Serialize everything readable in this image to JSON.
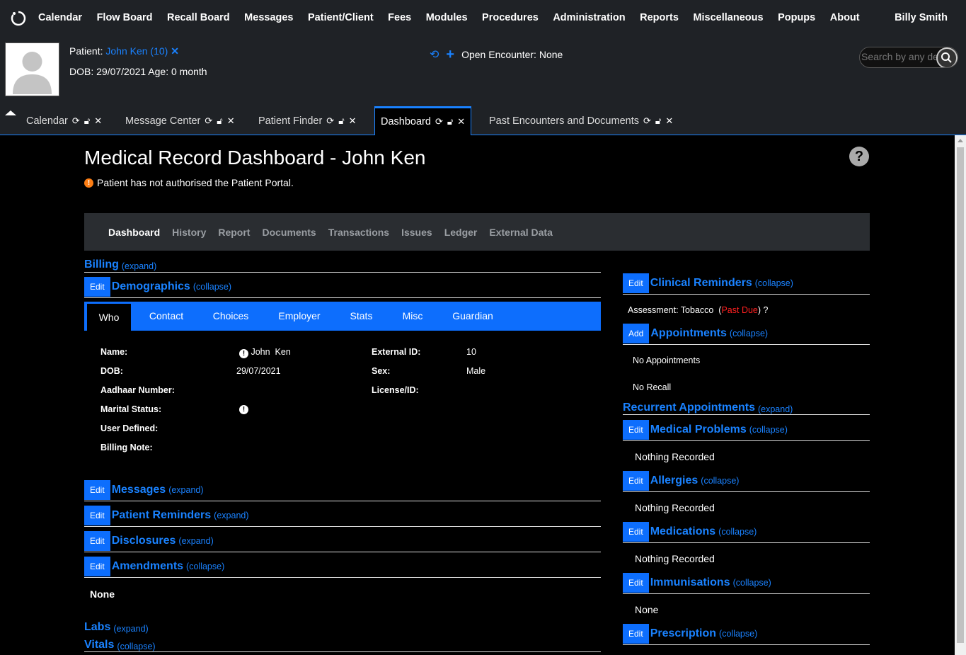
{
  "nav": {
    "items": [
      "Calendar",
      "Flow Board",
      "Recall Board",
      "Messages",
      "Patient/Client",
      "Fees",
      "Modules",
      "Procedures",
      "Administration",
      "Reports",
      "Miscellaneous",
      "Popups",
      "About"
    ],
    "user": "Billy Smith"
  },
  "patient": {
    "label": "Patient:",
    "name_link": "John Ken (10)",
    "dob_line": "DOB: 29/07/2021 Age: 0 month",
    "encounter": "Open Encounter: None",
    "search_placeholder": "Search by any demographics"
  },
  "tabs": [
    {
      "label": "Calendar"
    },
    {
      "label": "Message Center"
    },
    {
      "label": "Patient Finder"
    },
    {
      "label": "Dashboard"
    },
    {
      "label": "Past Encounters and Documents"
    }
  ],
  "page": {
    "title": "Medical Record Dashboard - John Ken",
    "notice": "Patient has not authorised the Patient Portal.",
    "help": "?"
  },
  "subnav": [
    "Dashboard",
    "History",
    "Report",
    "Documents",
    "Transactions",
    "Issues",
    "Ledger",
    "External Data"
  ],
  "left": {
    "billing": {
      "label": "Billing",
      "toggle": "(expand)"
    },
    "demographics": {
      "edit": "Edit",
      "label": "Demographics",
      "toggle": "(collapse)"
    },
    "demo_tabs": [
      "Who",
      "Contact",
      "Choices",
      "Employer",
      "Stats",
      "Misc",
      "Guardian"
    ],
    "fields": {
      "name_label": "Name:",
      "name_value": "John  Ken",
      "dob_label": "DOB:",
      "dob_value": "29/07/2021",
      "aadhaar_label": "Aadhaar Number:",
      "marital_label": "Marital Status:",
      "userdef_label": "User Defined:",
      "billnote_label": "Billing Note:",
      "extid_label": "External ID:",
      "extid_value": "10",
      "sex_label": "Sex:",
      "sex_value": "Male",
      "license_label": "License/ID:"
    },
    "messages": {
      "edit": "Edit",
      "label": "Messages",
      "toggle": "(expand)"
    },
    "reminders": {
      "edit": "Edit",
      "label": "Patient Reminders",
      "toggle": "(expand)"
    },
    "disclosures": {
      "edit": "Edit",
      "label": "Disclosures",
      "toggle": "(expand)"
    },
    "amendments": {
      "edit": "Edit",
      "label": "Amendments",
      "toggle": "(collapse)",
      "body": "None"
    },
    "labs": {
      "label": "Labs",
      "toggle": "(expand)"
    },
    "vitals": {
      "label": "Vitals",
      "toggle": "(collapse)"
    }
  },
  "right": {
    "clinical": {
      "edit": "Edit",
      "label": "Clinical Reminders",
      "toggle": "(collapse)",
      "assessment": "Assessment: Tobacco",
      "past_due": "Past Due",
      "q": "?"
    },
    "appointments": {
      "edit": "Add",
      "label": "Appointments",
      "toggle": "(collapse)",
      "none": "No Appointments",
      "recall": "No Recall"
    },
    "recurrent": {
      "label": "Recurrent Appointments",
      "toggle": "(expand)"
    },
    "problems": {
      "edit": "Edit",
      "label": "Medical Problems",
      "toggle": "(collapse)",
      "body": "Nothing Recorded"
    },
    "allergies": {
      "edit": "Edit",
      "label": "Allergies",
      "toggle": "(collapse)",
      "body": "Nothing Recorded"
    },
    "medications": {
      "edit": "Edit",
      "label": "Medications",
      "toggle": "(collapse)",
      "body": "Nothing Recorded"
    },
    "immunisations": {
      "edit": "Edit",
      "label": "Immunisations",
      "toggle": "(collapse)",
      "body": "None"
    },
    "prescription": {
      "edit": "Edit",
      "label": "Prescription",
      "toggle": "(collapse)"
    }
  },
  "colors": {
    "accent": "#1a82ff",
    "button": "#0d6efd",
    "navbg": "#1f2226",
    "warn": "#fd7e14",
    "pastdue": "#ff2020"
  }
}
